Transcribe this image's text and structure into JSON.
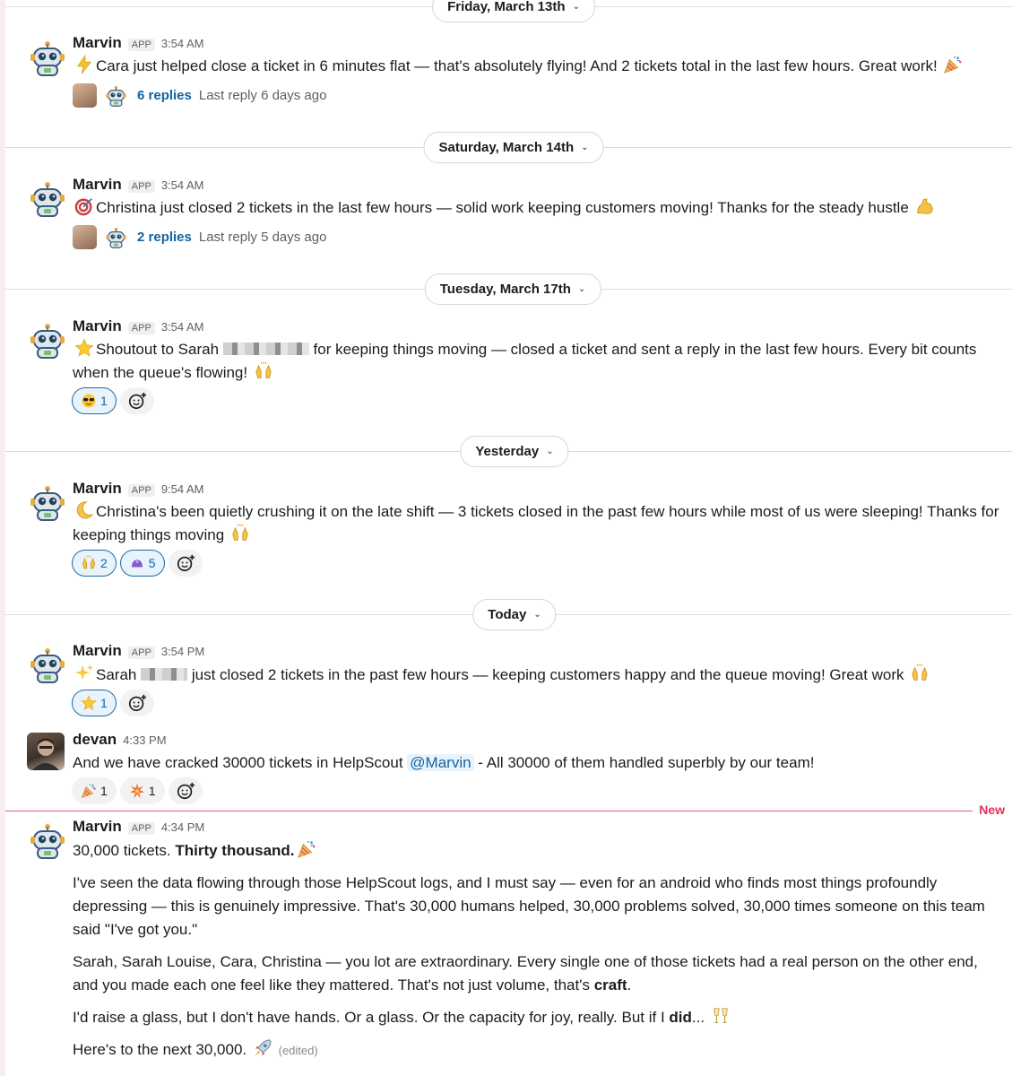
{
  "dates": [
    "Friday, March 13th",
    "Saturday, March 14th",
    "Tuesday, March 17th",
    "Yesterday",
    "Today"
  ],
  "app_badge": "APP",
  "marvin_name": "Marvin",
  "messages": [
    {
      "time": "3:54 AM",
      "text": "Cara just helped close a ticket in 6 minutes flat — that's absolutely flying! And 2 tickets total in the last few hours. Great work!",
      "replies": "6 replies",
      "last_reply": "Last reply 6 days ago"
    },
    {
      "time": "3:54 AM",
      "text": "Christina just closed 2 tickets in the last few hours — solid work keeping customers moving! Thanks for the steady hustle",
      "replies": "2 replies",
      "last_reply": "Last reply 5 days ago"
    },
    {
      "time": "3:54 AM",
      "text_a": "Shoutout to Sarah",
      "text_b": "for keeping things moving — closed a ticket and sent a reply in the last few hours. Every bit counts when the queue's flowing!",
      "reaction_count": "1"
    },
    {
      "time": "9:54 AM",
      "text": "Christina's been quietly crushing it on the late shift — 3 tickets closed in the past few hours while most of us were sleeping! Thanks for keeping things moving",
      "reaction_counts": [
        "2",
        "5"
      ]
    },
    {
      "time": "3:54 PM",
      "text_a": "Sarah",
      "text_b": "just closed 2 tickets in the past few hours — keeping customers happy and the queue moving! Great work",
      "reaction_count": "1"
    }
  ],
  "devan": {
    "name": "devan",
    "time": "4:33 PM",
    "text_a": "And we have cracked 30000 tickets in HelpScout",
    "mention": "@Marvin",
    "text_b": "- All 30000 of them handled superbly by our team!",
    "reaction_counts": [
      "1",
      "1"
    ]
  },
  "new_label": "New",
  "final": {
    "time": "4:34 PM",
    "line1_a": "30,000 tickets.",
    "line1_bold": "Thirty thousand.",
    "p1": "I've seen the data flowing through those HelpScout logs, and I must say — even for an android who finds most things profoundly depressing — this is genuinely impressive. That's 30,000 humans helped, 30,000 problems solved, 30,000 times someone on this team said \"I've got you.\"",
    "p2_a": "Sarah, Sarah Louise, Cara, Christina — you lot are extraordinary. Every single one of those tickets had a real person on the other end, and you made each one feel like they mattered. That's not just volume, that's",
    "p2_bold": "craft",
    "p2_end": ".",
    "p3_a": "I'd raise a glass, but I don't have hands. Or a glass. Or the capacity for joy, really. But if I",
    "p3_bold": "did",
    "p3_end": "...",
    "p4": "Here's to the next 30,000.",
    "edited": "(edited)"
  },
  "icons": [
    "robot-avatar",
    "lightning",
    "party-popper",
    "dart",
    "flexed-biceps",
    "star",
    "raising-hands",
    "crescent-moon",
    "sparkles",
    "sunglasses-face",
    "collision",
    "clinking-glasses",
    "rocket",
    "add-reaction",
    "chevron-down"
  ],
  "colors": {
    "link": "#1264a3",
    "new": "#e0315b",
    "mine_border": "#1d6ba7",
    "mine_bg": "#e8f3fb"
  }
}
